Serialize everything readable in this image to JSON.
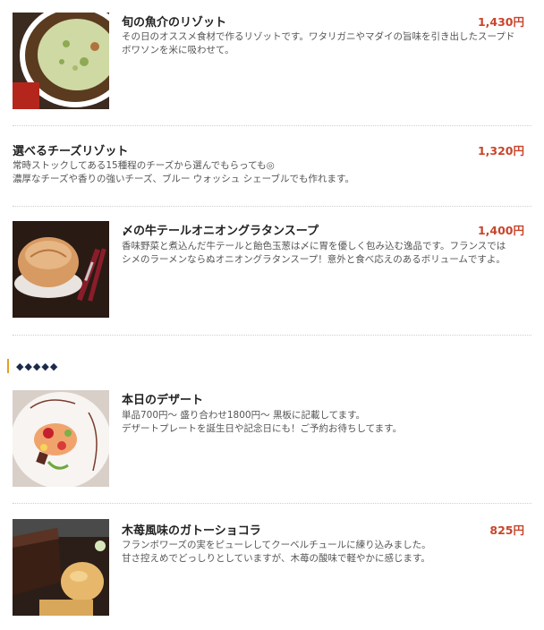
{
  "menu": {
    "items": [
      {
        "name": "旬の魚介のリゾット",
        "price": "1,430円",
        "desc": [
          "その日のオススメ食材で作るリゾットです。ワタリガニやマダイの旨味を引き出したスープド",
          "ボワソンを米に吸わせて。"
        ]
      },
      {
        "name": "選べるチーズリゾット",
        "price": "1,320円",
        "desc": [
          "常時ストックしてある15種程のチーズから選んでもらっても◎",
          "濃厚なチーズや香りの強いチーズ、ブルー ウォッシュ シェーブルでも作れます。"
        ]
      },
      {
        "name": "〆の牛テールオニオングラタンスープ",
        "price": "1,400円",
        "desc": [
          "香味野菜と煮込んだ牛テールと飴色玉葱は〆に胃を優しく包み込む逸品です。フランスでは",
          "シメのラーメンならぬオニオングラタンスープ！意外と食べ応えのあるボリュームですよ。"
        ]
      }
    ],
    "section_title": "◆◆◆◆◆",
    "dessert_items": [
      {
        "name": "本日のデザート",
        "desc": [
          "単品700円～ 盛り合わせ1800円～ 黒板に記載してます。",
          "デザートプレートを誕生日や記念日にも！ご予約お待ちしてます。"
        ]
      },
      {
        "name": "木苺風味のガトーショコラ",
        "price": "825円",
        "desc": [
          "フランボワーズの実をピューレしてクーベルチュールに練り込みました。",
          "甘さ控えめでどっしりとしていますが、木苺の酸味で軽やかに感じます。"
        ]
      }
    ]
  },
  "colors": {
    "price": "#c8452b",
    "section_bar": "#e0a126",
    "divider": "#cfcfcf"
  }
}
